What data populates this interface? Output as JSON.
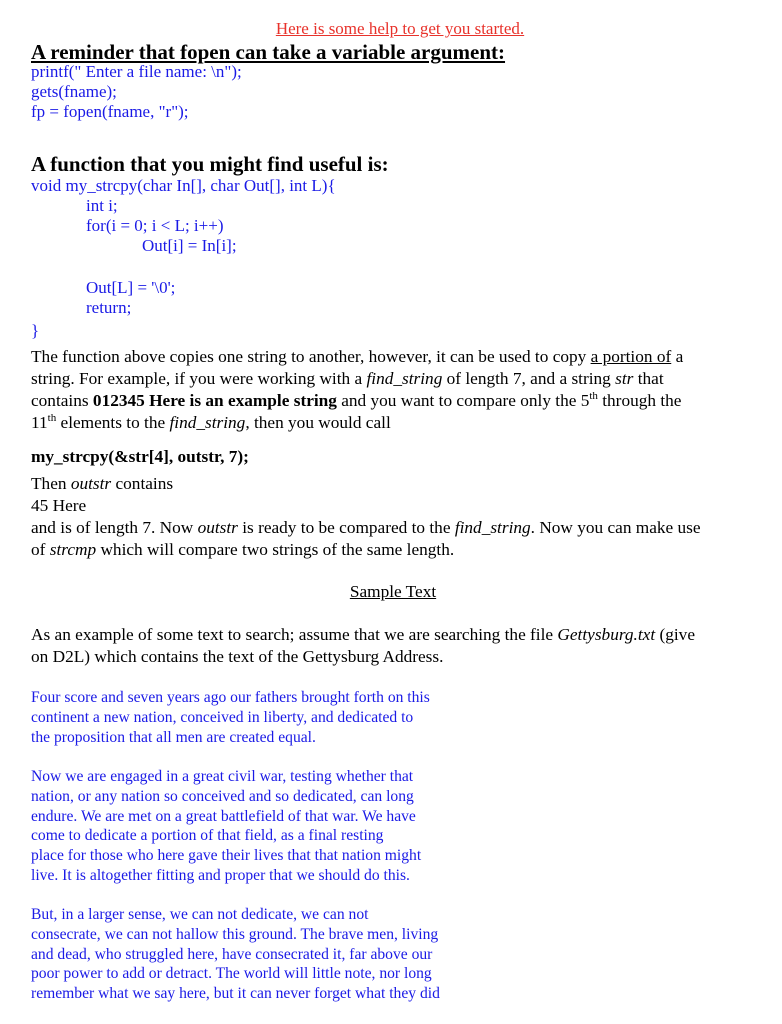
{
  "intro": "Here is some help to get you started.",
  "section1": {
    "heading": "A reminder that fopen can take a variable argument:",
    "code_lines": [
      "printf(\" Enter a file name: \\n\");",
      "gets(fname);",
      "fp = fopen(fname, \"r\");"
    ]
  },
  "section2": {
    "heading": "A function that you might find useful is:",
    "code_lines": [
      "void my_strcpy(char In[], char Out[], int L){",
      "int i;",
      "for(i = 0; i < L; i++)",
      "Out[i] = In[i];",
      "Out[L] = '\\0';",
      "return;",
      "}"
    ]
  },
  "explanation": {
    "line1_a": "The function above copies one string to another, however, it can be used to copy ",
    "line1_u": "a portion of",
    "line1_b": " a",
    "line2_a": "string. For example, if you were working with a ",
    "line2_i1": "find_string",
    "line2_b": " of length 7, and a string ",
    "line2_i2": "str",
    "line2_c": " that",
    "line3_a": "contains ",
    "line3_bold": "012345 Here is an example string",
    "line3_b": " and you want to compare only the 5",
    "line3_sup": "th",
    "line3_c": " through the",
    "line4_a": "11",
    "line4_sup": "th",
    "line4_b": " elements to the ",
    "line4_i": "find_string",
    "line4_c": ", then you would call"
  },
  "call_line": "my_strcpy(&str[4], outstr, 7);",
  "result": {
    "line1_a": "Then ",
    "line1_i": "outstr",
    "line1_b": " contains",
    "line2": "45 Here",
    "line3_a": "and is of length 7. Now ",
    "line3_i1": "outstr",
    "line3_b": " is ready to be compared to the ",
    "line3_i2": "find_string",
    "line3_c": ". Now you can make use",
    "line4_a": "of ",
    "line4_i": "strcmp",
    "line4_b": " which will compare two strings of the same length."
  },
  "sample": {
    "title": "Sample Text",
    "intro_line1_a": "As an example of some text to search; assume that we are searching the file ",
    "intro_line1_i": "Gettysburg.txt",
    "intro_line1_b": " (give",
    "intro_line2": "on D2L) which contains the text of the Gettysburg Address.",
    "paragraphs": [
      [
        "Four score and seven years ago our fathers brought forth on this",
        "continent a new nation, conceived in liberty, and dedicated to",
        "the proposition that all men are created equal."
      ],
      [
        "Now we are engaged in a great civil war, testing whether that",
        "nation, or any nation so conceived and so dedicated, can long",
        "endure. We are met on a great battlefield of that war. We have",
        "come to dedicate a portion of that field, as a final resting",
        "place for those who here gave their lives that that nation might",
        "live. It is altogether fitting and proper that we should do this."
      ],
      [
        "But, in a larger sense, we can not dedicate, we can not",
        "consecrate, we can not hallow this ground. The brave men, living",
        "and dead, who struggled here, have consecrated it, far above our",
        "poor power to add or detract. The world will little note, nor long",
        "remember what we say here, but it can never forget what they did"
      ]
    ]
  },
  "colors": {
    "intro": "#e8322b",
    "code": "#1a1ae6",
    "text": "#000000"
  }
}
